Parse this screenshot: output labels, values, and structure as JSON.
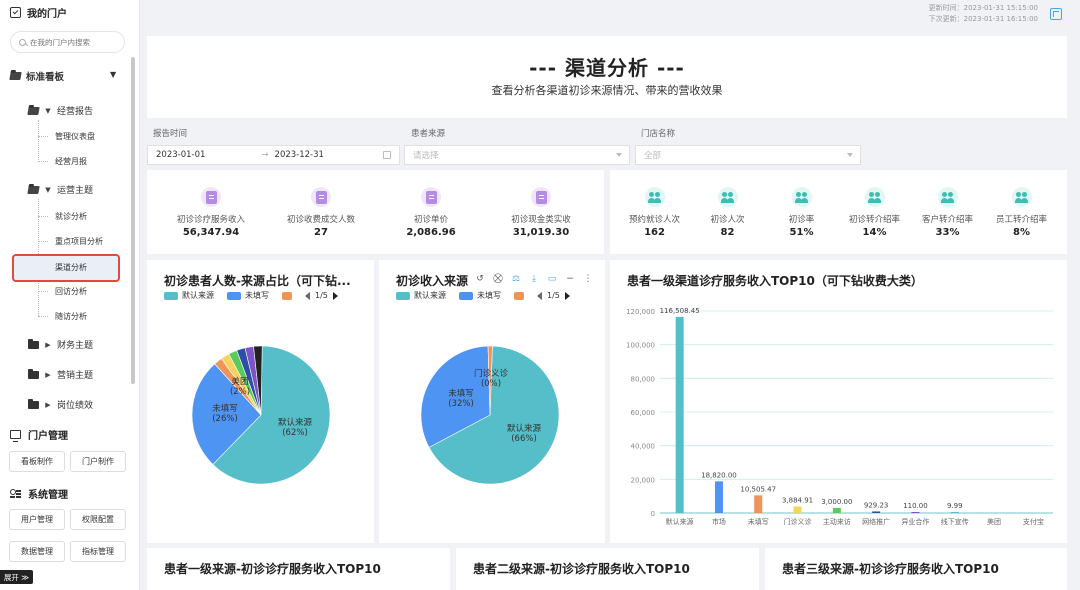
{
  "sidebar": {
    "portal_title": "我的门户",
    "search_placeholder": "在我的门户内搜索",
    "board_label": "标准看板",
    "groups": [
      {
        "label": "经营报告",
        "items": [
          "管理仪表盘",
          "经营月报"
        ]
      },
      {
        "label": "运营主题",
        "items": [
          "就诊分析",
          "重点项目分析",
          "渠道分析",
          "回访分析",
          "随访分析"
        ]
      },
      {
        "label": "财务主题"
      },
      {
        "label": "营销主题"
      },
      {
        "label": "岗位绩效"
      }
    ],
    "portal_mgmt": {
      "title": "门户管理",
      "buttons": [
        "看板制作",
        "门户制作"
      ]
    },
    "sys_mgmt": {
      "title": "系统管理",
      "buttons": [
        "用户管理",
        "权限配置",
        "数据管理",
        "指标管理"
      ]
    },
    "expand_label": "展开 ≫"
  },
  "topbar": {
    "update_time": "更新时间：2023-01-31 15:15:00",
    "next_update": "下次更新：2023-01-31 16:15:00"
  },
  "header": {
    "title": "--- 渠道分析 ---",
    "subtitle": "查看分析各渠道初诊来源情况、带来的营收效果"
  },
  "filters": {
    "report_time_label": "报告时间",
    "start_date": "2023-01-01",
    "arrow": "→",
    "end_date": "2023-12-31",
    "source_label": "患者来源",
    "source_placeholder": "请选择",
    "store_label": "门店名称",
    "store_value": "全部"
  },
  "kpis_left": [
    {
      "label": "初诊诊疗服务收入",
      "value": "56,347.94"
    },
    {
      "label": "初诊收费成交人数",
      "value": "27"
    },
    {
      "label": "初诊单价",
      "value": "2,086.96"
    },
    {
      "label": "初诊现金类实收",
      "value": "31,019.30"
    }
  ],
  "kpis_right": [
    {
      "label": "预约就诊人次",
      "value": "162"
    },
    {
      "label": "初诊人次",
      "value": "82"
    },
    {
      "label": "初诊率",
      "value": "51%"
    },
    {
      "label": "初诊转介绍率",
      "value": "14%"
    },
    {
      "label": "客户转介绍率",
      "value": "33%"
    },
    {
      "label": "员工转介绍率",
      "value": "8%"
    }
  ],
  "pie1": {
    "title": "初诊患者人数-来源占比（可下钻...",
    "legend": [
      "默认来源",
      "未填写"
    ],
    "page": "1/5"
  },
  "pie2": {
    "title": "初诊收入来源",
    "legend": [
      "默认来源",
      "未填写"
    ],
    "page": "1/5",
    "tools": [
      "↺",
      "⛒",
      "⚖",
      "⤓",
      "▭",
      "−",
      "⋮"
    ]
  },
  "bar": {
    "title": "患者一级渠道诊疗服务收入TOP10（可下钻收费大类）"
  },
  "bottom_titles": [
    "患者一级来源-初诊诊疗服务收入TOP10",
    "患者二级来源-初诊诊疗服务收入TOP10",
    "患者三级来源-初诊诊疗服务收入TOP10"
  ],
  "colors": {
    "teal": "#56bec8",
    "blue": "#4e94f3",
    "orange": "#f0945a",
    "yellow": "#f4d35e",
    "green": "#5bc95b",
    "navy": "#2e4fa8",
    "purple": "#7c54c7",
    "red_highlight": "#e24a3b"
  },
  "chart_data": [
    {
      "type": "pie",
      "title": "初诊患者人数-来源占比（可下钻...",
      "slices": [
        {
          "name": "默认来源",
          "label": "默认来源\n(62%)",
          "value": 62,
          "color": "#56bec8"
        },
        {
          "name": "未填写",
          "label": "未填写\n(26%)",
          "value": 26,
          "color": "#4e94f3"
        },
        {
          "name": "美团",
          "label": "美团\n(2%)",
          "value": 2,
          "color": "#f0945a"
        },
        {
          "name": "",
          "value": 2,
          "color": "#f4d35e"
        },
        {
          "name": "",
          "value": 2,
          "color": "#5bc95b"
        },
        {
          "name": "",
          "value": 2,
          "color": "#2e4fa8"
        },
        {
          "name": "",
          "value": 2,
          "color": "#7c54c7"
        },
        {
          "name": "",
          "value": 2,
          "color": "#222222"
        }
      ]
    },
    {
      "type": "pie",
      "title": "初诊收入来源",
      "slices": [
        {
          "name": "默认来源",
          "label": "默认来源\n(66%)",
          "value": 66,
          "color": "#56bec8"
        },
        {
          "name": "未填写",
          "label": "未填写\n(32%)",
          "value": 32,
          "color": "#4e94f3"
        },
        {
          "name": "门诊义诊",
          "label": "门诊义诊\n(0%)",
          "value": 1,
          "color": "#f0945a"
        }
      ]
    },
    {
      "type": "bar",
      "title": "患者一级渠道诊疗服务收入TOP10（可下钻收费大类）",
      "categories": [
        "默认来源",
        "市场",
        "未填写",
        "门诊义诊",
        "主动来访",
        "网络推广",
        "异业合作",
        "线下宣传",
        "美团",
        "支付宝"
      ],
      "values": [
        116508.45,
        18820.0,
        10505.47,
        3884.91,
        3000.0,
        929.23,
        110.0,
        9.99,
        0,
        0
      ],
      "value_labels": [
        "116,508.45",
        "18,820.00",
        "10,505.47",
        "3,884.91",
        "3,000.00",
        "929.23",
        "110.00",
        "9.99",
        "",
        ""
      ],
      "colors": [
        "#56bec8",
        "#4e94f3",
        "#f0945a",
        "#f4d35e",
        "#5bc95b",
        "#2e4fa8",
        "#7c54c7",
        "#56bec8",
        "#56bec8",
        "#56bec8"
      ],
      "yticks": [
        "0",
        "20,000",
        "40,000",
        "60,000",
        "80,000",
        "100,000",
        "120,000"
      ],
      "ylim": [
        0,
        120000
      ],
      "grid": true
    }
  ]
}
